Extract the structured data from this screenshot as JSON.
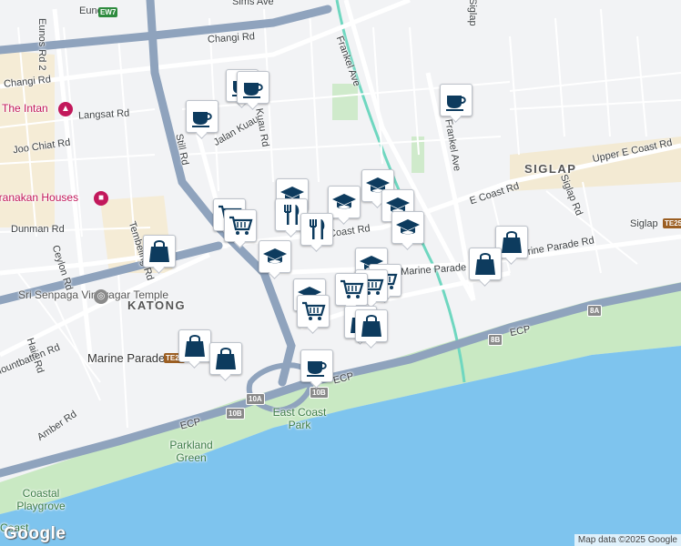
{
  "map": {
    "road_labels": [
      "Eunos",
      "Sims Ave",
      "Changi Rd",
      "Changi Rd",
      "Frankel Ave",
      "Siglap",
      "Langsat Rd",
      "Jalan Kuau",
      "Kuau Rd",
      "Joo Chiat Rd",
      "Still Rd",
      "Frankel Ave",
      "E Coast Rd",
      "Upper E Coast Rd",
      "Siglap Rd",
      "Siglap",
      "Dunman Rd",
      "Tembeling Rd",
      "Ceylon Rd",
      "Marine Parade Rd",
      "Marine Parade Rd",
      "Haig Rd",
      "Mountbatten Rd",
      "Amber Rd",
      "ECP",
      "ECP",
      "ECP",
      "East Coast Rd",
      "Eunos Rd 2"
    ],
    "area_labels": [
      "SIGLAP",
      "KATONG"
    ],
    "poi_labels": [
      "The Intan",
      "Peranakan Houses",
      "Sri Senpaga Vinayagar Temple",
      "Marine Parade"
    ],
    "park_labels": [
      "East Coast Park",
      "Parkland Green",
      "Coastal Playgrove",
      "Coast"
    ],
    "station_codes": [
      "EW7",
      "TE26",
      "TE25"
    ],
    "exit_shields": [
      "10A",
      "10B",
      "10B",
      "8B",
      "8A"
    ],
    "spot_icons": [
      "mortarboard-pink-icon",
      "temple-icon"
    ]
  },
  "markers": [
    {
      "type": "coffee",
      "icon": "coffee-cup-icon"
    },
    {
      "type": "coffee",
      "icon": "coffee-cup-icon"
    },
    {
      "type": "coffee",
      "icon": "coffee-cup-icon"
    },
    {
      "type": "coffee",
      "icon": "coffee-cup-icon"
    },
    {
      "type": "coffee",
      "icon": "coffee-cup-icon"
    },
    {
      "type": "school",
      "icon": "graduation-cap-icon"
    },
    {
      "type": "school",
      "icon": "graduation-cap-icon"
    },
    {
      "type": "school",
      "icon": "graduation-cap-icon"
    },
    {
      "type": "school",
      "icon": "graduation-cap-icon"
    },
    {
      "type": "school",
      "icon": "graduation-cap-icon"
    },
    {
      "type": "school",
      "icon": "graduation-cap-icon"
    },
    {
      "type": "school",
      "icon": "graduation-cap-icon"
    },
    {
      "type": "school",
      "icon": "graduation-cap-icon"
    },
    {
      "type": "restaurant",
      "icon": "fork-knife-icon"
    },
    {
      "type": "restaurant",
      "icon": "fork-knife-icon"
    },
    {
      "type": "grocery",
      "icon": "shopping-cart-icon"
    },
    {
      "type": "grocery",
      "icon": "shopping-cart-icon"
    },
    {
      "type": "grocery",
      "icon": "shopping-cart-icon"
    },
    {
      "type": "grocery",
      "icon": "shopping-cart-icon"
    },
    {
      "type": "grocery",
      "icon": "shopping-cart-icon"
    },
    {
      "type": "grocery",
      "icon": "shopping-cart-icon"
    },
    {
      "type": "shopping",
      "icon": "shopping-bag-icon"
    },
    {
      "type": "shopping",
      "icon": "shopping-bag-icon"
    },
    {
      "type": "shopping",
      "icon": "shopping-bag-icon"
    },
    {
      "type": "shopping",
      "icon": "shopping-bag-icon"
    },
    {
      "type": "shopping",
      "icon": "shopping-bag-icon"
    },
    {
      "type": "shopping",
      "icon": "shopping-bag-icon"
    },
    {
      "type": "shopping",
      "icon": "shopping-bag-icon"
    }
  ],
  "colors": {
    "water": "#7ec4ee",
    "park": "#c9e9c3",
    "highway": "#8fa3bd",
    "marker_icon": "#0d3b5e",
    "rail": "#6fd7c0"
  },
  "footer": {
    "logo": "Google",
    "attribution": "Map data ©2025 Google"
  }
}
